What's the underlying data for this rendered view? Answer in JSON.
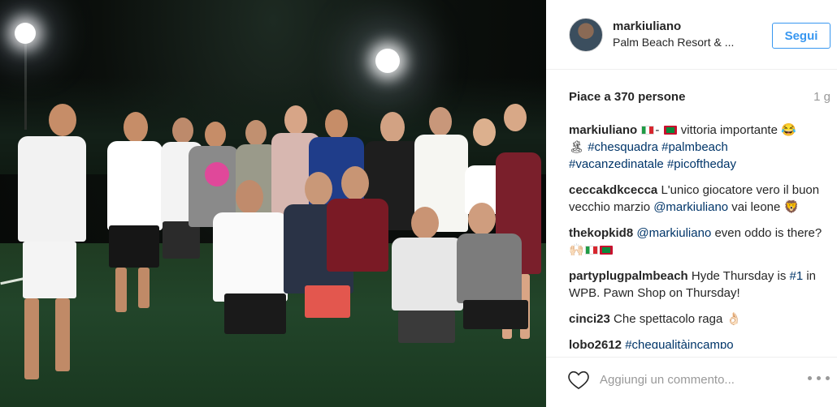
{
  "post": {
    "username": "markiuliano",
    "location": "Palm Beach Resort & ...",
    "follow_label": "Segui",
    "likes_text": "Piace a 370 persone",
    "age": "1 g"
  },
  "comments": [
    {
      "user": "markiuliano",
      "parts": [
        {
          "t": "flag-it"
        },
        {
          "t": "text",
          "v": "- "
        },
        {
          "t": "flag-mv"
        },
        {
          "t": "text",
          "v": " vittoria importante "
        },
        {
          "t": "emoji",
          "v": "😂"
        },
        {
          "t": "br"
        },
        {
          "t": "emoji",
          "v": "🏝"
        },
        {
          "t": "text",
          "v": " "
        },
        {
          "t": "link",
          "v": "#chesquadra"
        },
        {
          "t": "text",
          "v": " "
        },
        {
          "t": "link",
          "v": "#palmbeach"
        },
        {
          "t": "br"
        },
        {
          "t": "link",
          "v": "#vacanzedinatale"
        },
        {
          "t": "text",
          "v": " "
        },
        {
          "t": "link",
          "v": "#picoftheday"
        }
      ]
    },
    {
      "user": "ceccakdkcecca",
      "parts": [
        {
          "t": "text",
          "v": "L'unico giocatore vero il buon vecchio marzio "
        },
        {
          "t": "link",
          "v": "@markiuliano"
        },
        {
          "t": "text",
          "v": " vai leone "
        },
        {
          "t": "emoji",
          "v": "🦁"
        }
      ]
    },
    {
      "user": "thekopkid8",
      "parts": [
        {
          "t": "link",
          "v": "@markiuliano"
        },
        {
          "t": "text",
          "v": " even oddo is there? "
        },
        {
          "t": "emoji",
          "v": "🙌🏻"
        },
        {
          "t": "flag-it"
        },
        {
          "t": "flag-mv"
        }
      ]
    },
    {
      "user": "partyplugpalmbeach",
      "parts": [
        {
          "t": "text",
          "v": "Hyde Thursday is "
        },
        {
          "t": "link",
          "v": "#1"
        },
        {
          "t": "text",
          "v": " in WPB. Pawn Shop on Thursday!"
        }
      ]
    },
    {
      "user": "cinci23",
      "parts": [
        {
          "t": "text",
          "v": "Che spettacolo raga "
        },
        {
          "t": "emoji",
          "v": "👌🏻"
        }
      ]
    },
    {
      "user": "lobo2612",
      "parts": [
        {
          "t": "link",
          "v": "#chequalitàincampo"
        }
      ]
    }
  ],
  "composer": {
    "placeholder": "Aggiungi un commento..."
  },
  "icons": {
    "like": "heart-icon",
    "more": "more-options-icon"
  },
  "colors": {
    "accent": "#3897f0",
    "link": "#003569",
    "muted": "#999999"
  }
}
